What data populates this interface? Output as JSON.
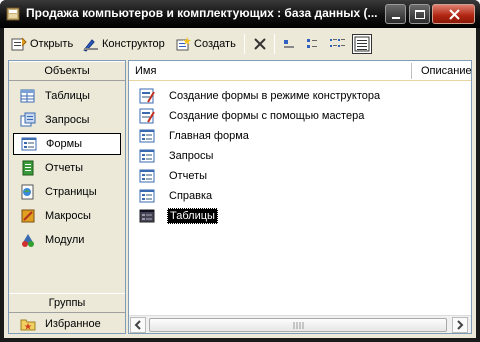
{
  "window": {
    "title": "Продажа компьютеров и комплектующих : база данных (...",
    "controls": [
      "minimize",
      "maximize",
      "close"
    ]
  },
  "toolbar": {
    "open_label": "Открыть",
    "design_label": "Конструктор",
    "create_label": "Создать",
    "views": [
      "large-icons",
      "small-icons",
      "list",
      "details"
    ],
    "active_view": "details"
  },
  "objects": {
    "header": "Объекты",
    "items": [
      {
        "label": "Таблицы",
        "icon": "table-icon"
      },
      {
        "label": "Запросы",
        "icon": "query-icon"
      },
      {
        "label": "Формы",
        "icon": "form-icon"
      },
      {
        "label": "Отчеты",
        "icon": "report-icon"
      },
      {
        "label": "Страницы",
        "icon": "page-icon"
      },
      {
        "label": "Макросы",
        "icon": "macro-icon"
      },
      {
        "label": "Модули",
        "icon": "module-icon"
      }
    ],
    "selected": "Формы"
  },
  "groups": {
    "header": "Группы",
    "items": [
      {
        "label": "Избранное",
        "icon": "favorites-folder-icon"
      }
    ]
  },
  "list": {
    "columns": [
      "Имя",
      "Описание"
    ],
    "items": [
      {
        "label": "Создание формы в режиме конструктора",
        "icon": "wizard-form-icon"
      },
      {
        "label": "Создание формы с помощью мастера",
        "icon": "wizard-form-icon"
      },
      {
        "label": "Главная форма",
        "icon": "form-icon"
      },
      {
        "label": "Запросы",
        "icon": "form-icon"
      },
      {
        "label": "Отчеты",
        "icon": "form-icon"
      },
      {
        "label": "Справка",
        "icon": "form-icon"
      },
      {
        "label": "Таблицы",
        "icon": "form-icon"
      }
    ],
    "selected": "Таблицы"
  },
  "colors": {
    "titlebar": "#000000",
    "panel": "#ece9d8",
    "border": "#7f9db9",
    "selection": "#000000"
  }
}
